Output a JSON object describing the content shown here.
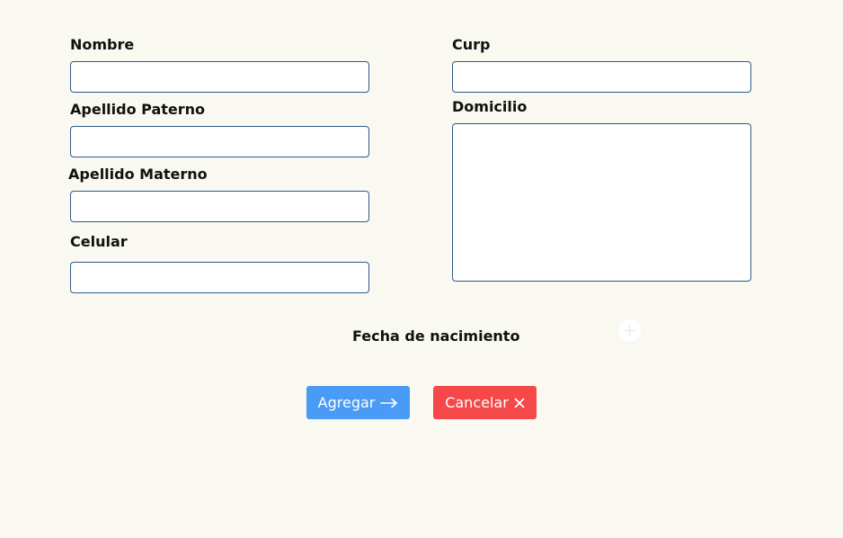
{
  "form": {
    "nombre": {
      "label": "Nombre",
      "value": ""
    },
    "apellido_paterno": {
      "label": "Apellido Paterno",
      "value": ""
    },
    "apellido_materno": {
      "label": "Apellido Materno",
      "value": ""
    },
    "celular": {
      "label": "Celular",
      "value": ""
    },
    "curp": {
      "label": "Curp",
      "value": ""
    },
    "domicilio": {
      "label": "Domicilio",
      "value": ""
    },
    "fecha_nacimiento": {
      "label": "Fecha de nacimiento"
    }
  },
  "actions": {
    "add_label": "Agregar",
    "cancel_label": "Cancelar"
  },
  "icons": {
    "add": "plus-circle-icon",
    "arrow": "arrow-right-icon",
    "cancel": "close-icon"
  },
  "colors": {
    "background": "#f9f9f1",
    "field_border": "#2e5b87",
    "add_button": "#4a9bf5",
    "cancel_button": "#f54848"
  }
}
